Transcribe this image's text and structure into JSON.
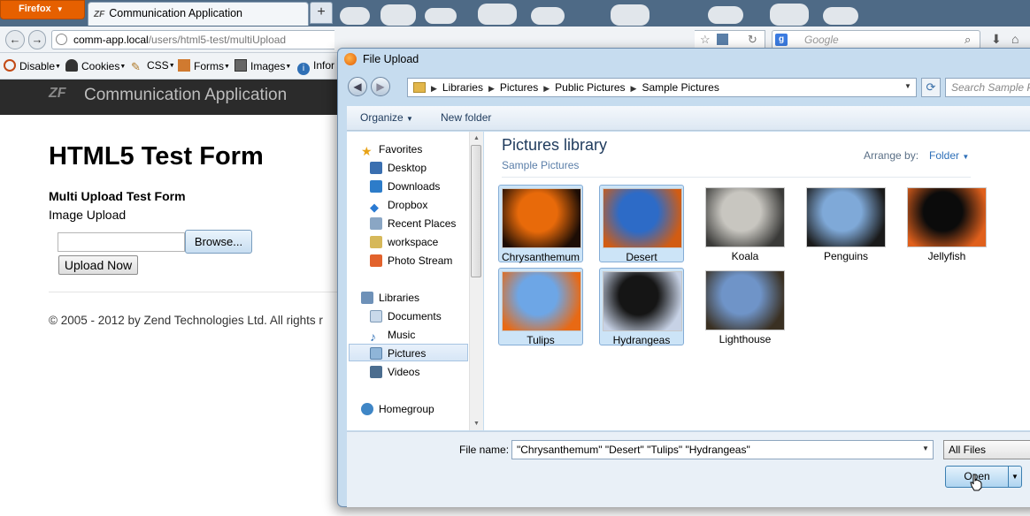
{
  "browser": {
    "menu_button": "Firefox",
    "tab_title": "Communication Application",
    "tab_logo": "ZF",
    "url_host": "comm-app.local",
    "url_path": "/users/html5-test/multiUpload",
    "search_placeholder": "Google",
    "search_engine_icon": "google-icon",
    "devbar": [
      {
        "label": "Disable",
        "icon": "no-icon",
        "color": "#c24a16"
      },
      {
        "label": "Cookies",
        "icon": "person-icon",
        "color": "#333333"
      },
      {
        "label": "CSS",
        "icon": "wand-icon",
        "color": "#b07a2a"
      },
      {
        "label": "Forms",
        "icon": "form-icon",
        "color": "#d07a30"
      },
      {
        "label": "Images",
        "icon": "image-icon",
        "color": "#555555"
      },
      {
        "label": "Infor",
        "icon": "info-icon",
        "color": "#2f6fb5"
      }
    ]
  },
  "page": {
    "app_logo": "ZF",
    "app_title": "Communication Application",
    "heading": "HTML5 Test Form",
    "form_title": "Multi Upload Test Form",
    "upload_label": "Image Upload",
    "browse_label": "Browse...",
    "upload_button": "Upload Now",
    "copyright": "© 2005 - 2012 by Zend Technologies Ltd. All rights r"
  },
  "dialog": {
    "title": "File Upload",
    "breadcrumb": [
      "Libraries",
      "Pictures",
      "Public Pictures",
      "Sample Pictures"
    ],
    "search_placeholder": "Search Sample P",
    "toolbar": {
      "organize": "Organize",
      "new_folder": "New folder"
    },
    "nav": {
      "favorites_header": "Favorites",
      "favorites": [
        "Desktop",
        "Downloads",
        "Dropbox",
        "Recent Places",
        "workspace",
        "Photo Stream"
      ],
      "libraries_header": "Libraries",
      "libraries": [
        "Documents",
        "Music",
        "Pictures",
        "Videos"
      ],
      "selected": "Pictures",
      "homegroup": "Homegroup"
    },
    "library_title": "Pictures library",
    "library_subtitle": "Sample Pictures",
    "arrange_label": "Arrange by:",
    "arrange_value": "Folder",
    "files": [
      {
        "name": "Chrysanthemum",
        "selected": true,
        "colors": [
          "#e86a0a",
          "#1c0d05"
        ]
      },
      {
        "name": "Desert",
        "selected": true,
        "colors": [
          "#2d6bc7",
          "#d25c12"
        ]
      },
      {
        "name": "Koala",
        "selected": false,
        "colors": [
          "#c8c6c0",
          "#3a3a38"
        ]
      },
      {
        "name": "Penguins",
        "selected": false,
        "colors": [
          "#7fa9d8",
          "#1a1a1a"
        ]
      },
      {
        "name": "Jellyfish",
        "selected": false,
        "colors": [
          "#0b0b0b",
          "#e0601c"
        ]
      },
      {
        "name": "Tulips",
        "selected": true,
        "colors": [
          "#6da6e6",
          "#e86914"
        ]
      },
      {
        "name": "Hydrangeas",
        "selected": true,
        "colors": [
          "#151515",
          "#c7d2e6"
        ]
      },
      {
        "name": "Lighthouse",
        "selected": false,
        "colors": [
          "#6f94c8",
          "#3a3022"
        ]
      }
    ],
    "file_name_label": "File name:",
    "file_name_value": "\"Chrysanthemum\" \"Desert\" \"Tulips\" \"Hydrangeas\"",
    "filter_value": "All Files",
    "open_button": "Open"
  }
}
